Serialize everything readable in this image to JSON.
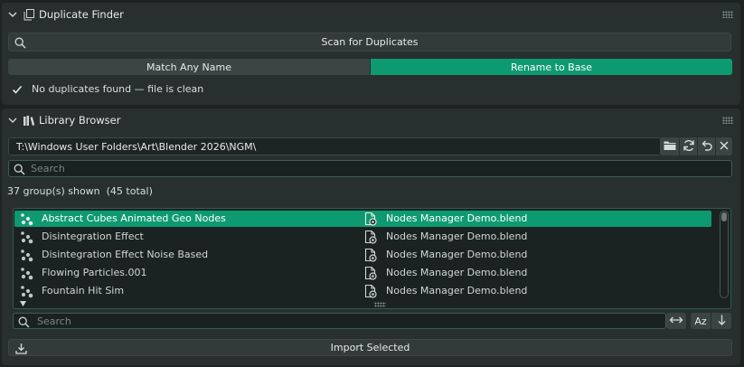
{
  "duplicate_finder": {
    "title": "Duplicate Finder",
    "scan_label": "Scan for Duplicates",
    "match_any_label": "Match Any Name",
    "rename_label": "Rename to Base",
    "status": "No duplicates found — file is clean"
  },
  "library_browser": {
    "title": "Library Browser",
    "path": "T:\\Windows User Folders\\Art\\Blender 2026\\NGM\\",
    "search_placeholder": "Search",
    "count_text": "37 group(s) shown  (45 total)",
    "rows": [
      {
        "name": "Abstract Cubes Animated Geo Nodes",
        "file": "Nodes Manager Demo.blend",
        "selected": true
      },
      {
        "name": "Disintegration Effect",
        "file": "Nodes Manager Demo.blend",
        "selected": false
      },
      {
        "name": "Disintegration Effect Noise Based",
        "file": "Nodes Manager Demo.blend",
        "selected": false
      },
      {
        "name": "Flowing Particles.001",
        "file": "Nodes Manager Demo.blend",
        "selected": false
      },
      {
        "name": "Fountain Hit Sim",
        "file": "Nodes Manager Demo.blend",
        "selected": false
      }
    ],
    "filter_placeholder": "Search",
    "sort_label": "Az",
    "import_label": "Import Selected"
  },
  "colors": {
    "accent": "#0e9a70",
    "panel": "#27302f",
    "field": "#1a2221"
  }
}
